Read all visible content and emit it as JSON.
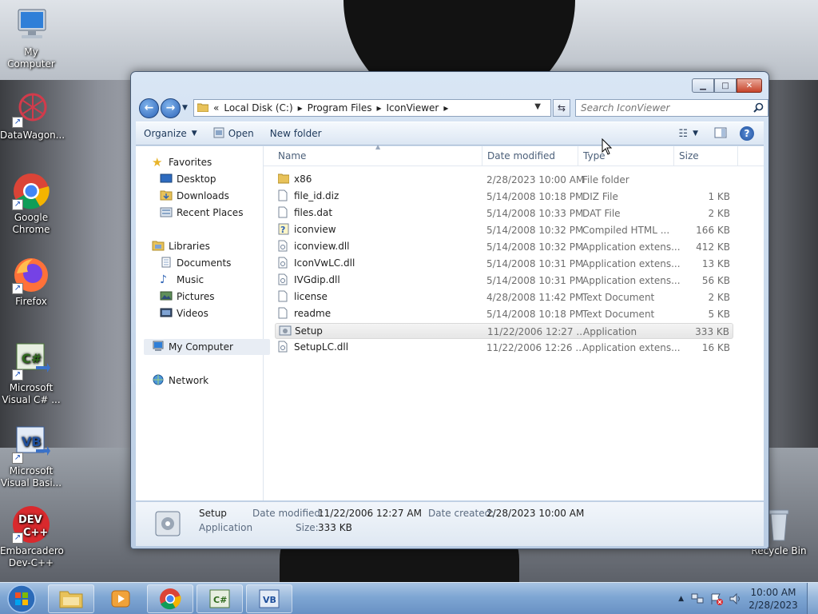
{
  "desktop": {
    "icons": [
      {
        "label": "My Computer"
      },
      {
        "label": "DataWagon..."
      },
      {
        "label": "Google Chrome"
      },
      {
        "label": "Firefox"
      },
      {
        "label": "Microsoft Visual C# ..."
      },
      {
        "label": "Microsoft Visual Basi..."
      },
      {
        "label": "Embarcadero Dev-C++"
      },
      {
        "label": "Recycle Bin"
      }
    ]
  },
  "window": {
    "address": {
      "chevron": "«",
      "segments": [
        "Local Disk (C:)",
        "Program Files",
        "IconViewer"
      ]
    },
    "search_placeholder": "Search IconViewer",
    "toolbar": {
      "organize": "Organize",
      "open": "Open",
      "new_folder": "New folder"
    },
    "nav": {
      "favorites": "Favorites",
      "desktop": "Desktop",
      "downloads": "Downloads",
      "recent_places": "Recent Places",
      "libraries": "Libraries",
      "documents": "Documents",
      "music": "Music",
      "pictures": "Pictures",
      "videos": "Videos",
      "my_computer": "My Computer",
      "network": "Network"
    },
    "columns": {
      "name": "Name",
      "date": "Date modified",
      "type": "Type",
      "size": "Size"
    },
    "files": [
      {
        "name": "x86",
        "date": "2/28/2023 10:00 AM",
        "type": "File folder",
        "size": ""
      },
      {
        "name": "file_id.diz",
        "date": "5/14/2008 10:18 PM",
        "type": "DIZ File",
        "size": "1 KB"
      },
      {
        "name": "files.dat",
        "date": "5/14/2008 10:33 PM",
        "type": "DAT File",
        "size": "2 KB"
      },
      {
        "name": "iconview",
        "date": "5/14/2008 10:32 PM",
        "type": "Compiled HTML ...",
        "size": "166 KB"
      },
      {
        "name": "iconview.dll",
        "date": "5/14/2008 10:32 PM",
        "type": "Application extens...",
        "size": "412 KB"
      },
      {
        "name": "IconVwLC.dll",
        "date": "5/14/2008 10:31 PM",
        "type": "Application extens...",
        "size": "13 KB"
      },
      {
        "name": "IVGdip.dll",
        "date": "5/14/2008 10:31 PM",
        "type": "Application extens...",
        "size": "56 KB"
      },
      {
        "name": "license",
        "date": "4/28/2008 11:42 PM",
        "type": "Text Document",
        "size": "2 KB"
      },
      {
        "name": "readme",
        "date": "5/14/2008 10:18 PM",
        "type": "Text Document",
        "size": "5 KB"
      },
      {
        "name": "Setup",
        "date": "11/22/2006 12:27 ...",
        "type": "Application",
        "size": "333 KB"
      },
      {
        "name": "SetupLC.dll",
        "date": "11/22/2006 12:26 ...",
        "type": "Application extens...",
        "size": "16 KB"
      }
    ],
    "details": {
      "name": "Setup",
      "kind": "Application",
      "date_modified_label": "Date modified:",
      "date_modified": "11/22/2006 12:27 AM",
      "date_created_label": "Date created:",
      "date_created": "2/28/2023 10:00 AM",
      "size_label": "Size:",
      "size": "333 KB"
    }
  },
  "taskbar": {
    "time": "10:00 AM",
    "date": "2/28/2023"
  }
}
